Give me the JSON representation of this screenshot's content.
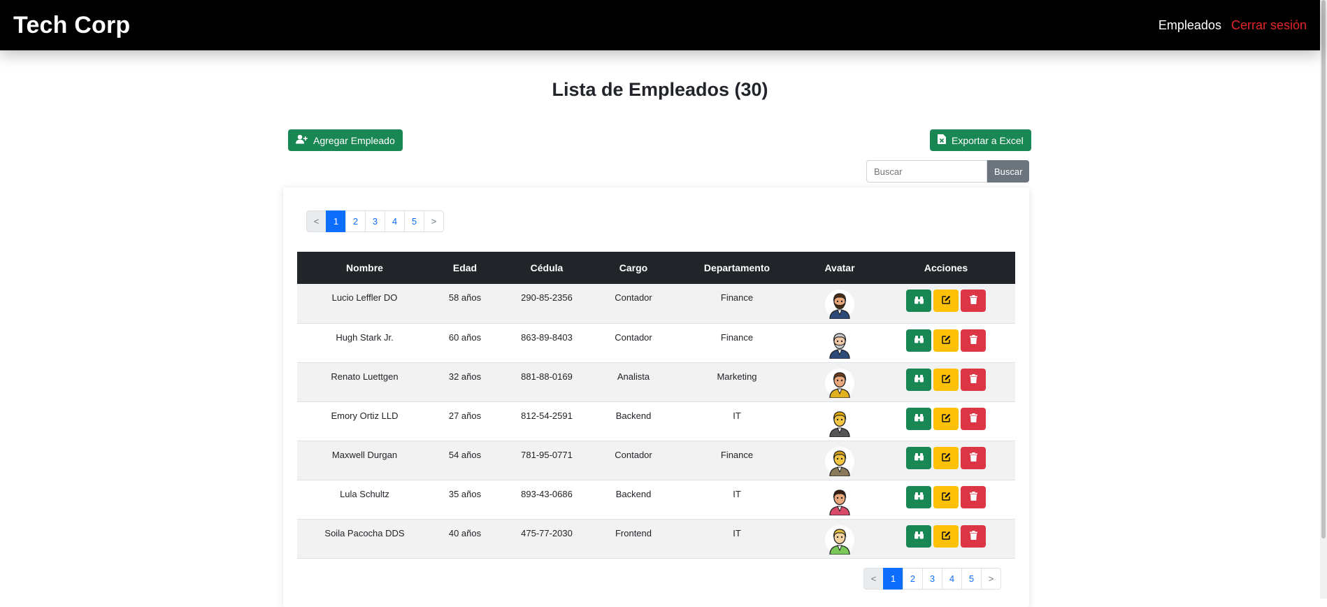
{
  "navbar": {
    "brand": "Tech Corp",
    "employees_link": "Empleados",
    "logout_link": "Cerrar sesión"
  },
  "page": {
    "title": "Lista de Empleados (30)"
  },
  "toolbar": {
    "add_label": "Agregar Empleado",
    "export_label": "Exportar a Excel",
    "search_placeholder": "Buscar",
    "search_button": "Buscar"
  },
  "pagination": {
    "prev": "<",
    "next": ">",
    "pages": [
      "1",
      "2",
      "3",
      "4",
      "5"
    ],
    "active": "1"
  },
  "table": {
    "columns": [
      "Nombre",
      "Edad",
      "Cédula",
      "Cargo",
      "Departamento",
      "Avatar",
      "Acciones"
    ],
    "rows": [
      {
        "nombre": "Lucio Leffler DO",
        "edad": "58 años",
        "cedula": "290-85-2356",
        "cargo": "Contador",
        "departamento": "Finance",
        "avatar": {
          "skin": "#e8a87c",
          "hair": "#4a2c14",
          "shirt": "#2d4a78",
          "beard": true
        }
      },
      {
        "nombre": "Hugh Stark Jr.",
        "edad": "60 años",
        "cedula": "863-89-8403",
        "cargo": "Contador",
        "departamento": "Finance",
        "avatar": {
          "skin": "#f1c9a5",
          "hair": "#c9c9c9",
          "shirt": "#2d4a78",
          "beard": true
        }
      },
      {
        "nombre": "Renato Luettgen",
        "edad": "32 años",
        "cedula": "881-88-0169",
        "cargo": "Analista",
        "departamento": "Marketing",
        "avatar": {
          "skin": "#e8a87c",
          "hair": "#6b3a1a",
          "shirt": "#e0b020",
          "beard": false
        }
      },
      {
        "nombre": "Emory Ortiz LLD",
        "edad": "27 años",
        "cedula": "812-54-2591",
        "cargo": "Backend",
        "departamento": "IT",
        "avatar": {
          "skin": "#f4c542",
          "hair": "#e0a800",
          "shirt": "#555555",
          "beard": false
        }
      },
      {
        "nombre": "Maxwell Durgan",
        "edad": "54 años",
        "cedula": "781-95-0771",
        "cargo": "Contador",
        "departamento": "Finance",
        "avatar": {
          "skin": "#f4c542",
          "hair": "#d4a017",
          "shirt": "#8a7a5a",
          "beard": false
        }
      },
      {
        "nombre": "Lula Schultz",
        "edad": "35 años",
        "cedula": "893-43-0686",
        "cargo": "Backend",
        "departamento": "IT",
        "avatar": {
          "skin": "#e8a87c",
          "hair": "#3a1f10",
          "shirt": "#d94a6a",
          "beard": false
        }
      },
      {
        "nombre": "Soila Pacocha DDS",
        "edad": "40 años",
        "cedula": "475-77-2030",
        "cargo": "Frontend",
        "departamento": "IT",
        "avatar": {
          "skin": "#f4d3a0",
          "hair": "#e8c040",
          "shirt": "#7ac85a",
          "beard": false
        }
      }
    ]
  },
  "colors": {
    "success": "#198754",
    "warning": "#ffc107",
    "danger": "#dc3545",
    "primary": "#0d6efd",
    "navbar": "#000000",
    "logout": "#e3242b"
  },
  "icons": {
    "add": "user-plus-icon",
    "export": "file-excel-icon",
    "view": "binoculars-icon",
    "edit": "edit-icon",
    "delete": "trash-icon"
  }
}
